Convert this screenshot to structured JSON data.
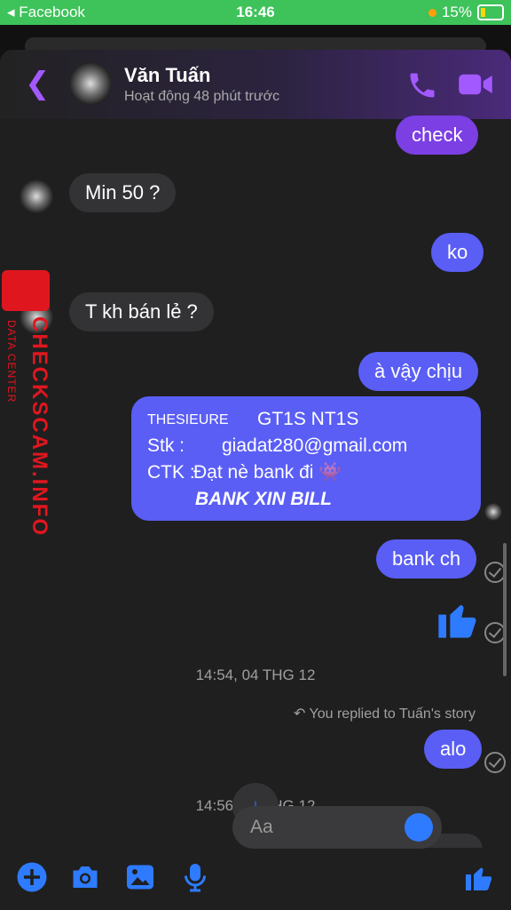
{
  "status_bar": {
    "carrier": "◂ Facebook",
    "time": "16:46",
    "battery": "15%"
  },
  "header": {
    "name": "Văn Tuấn",
    "status": "Hoạt động 48 phút trước"
  },
  "messages": {
    "m1": "check",
    "m2": "Min 50 ?",
    "m3": "ko",
    "m4": "T kh bán lẻ ?",
    "m5": "à vậy chịu"
  },
  "card": {
    "label1": "THESIEURE",
    "value1": "GT1S NT1S",
    "label2": "Stk :",
    "value2": "giadat280@gmail.com",
    "label3": "CTK :",
    "value3": "Đạt nè bank đi 👾",
    "note": "BANK XIN BILL"
  },
  "messages2": {
    "m6": "bank ch",
    "m7": "alo"
  },
  "timestamps": {
    "t1": "14:54, 04 THG 12",
    "t2": "14:56, 04 THG 12"
  },
  "replied_note": "You replied to Tuấn's story",
  "composer": {
    "placeholder": "Aa"
  },
  "watermark": {
    "brand": "CHECKSCAM.INFO",
    "sub": "DATA CENTER"
  },
  "colors": {
    "outgoing": "#5a5ef5",
    "incoming": "#333336",
    "accent": "#a259ff",
    "icon_blue": "#2e7bff"
  }
}
